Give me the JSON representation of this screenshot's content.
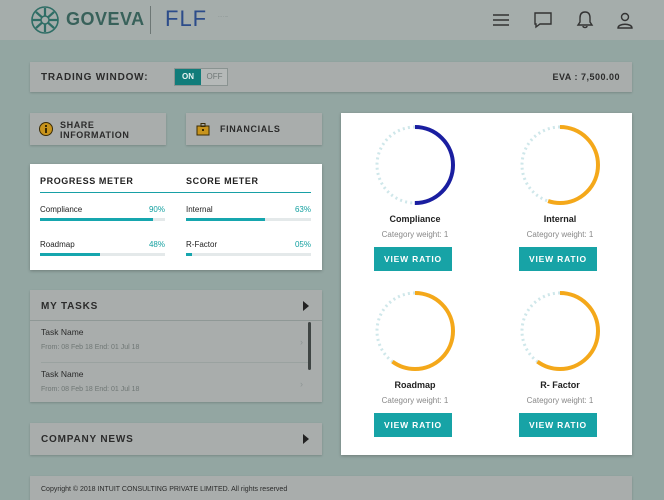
{
  "header": {
    "brand": "GOVEVA",
    "partner": "FLF",
    "partner_sub": "··· ····",
    "icons": [
      "menu-icon",
      "chat-icon",
      "bell-icon",
      "user-icon"
    ]
  },
  "trading": {
    "label": "TRADING WINDOW:",
    "on": "ON",
    "off": "OFF",
    "eva": "EVA : 7,500.00"
  },
  "buttons": {
    "share": "SHARE INFORMATION",
    "financials": "FINANCIALS"
  },
  "meters": {
    "progress_title": "PROGRESS METER",
    "score_title": "SCORE METER",
    "progress": [
      {
        "name": "Compliance",
        "percent": "90%",
        "value": 90
      },
      {
        "name": "Roadmap",
        "percent": "48%",
        "value": 48
      }
    ],
    "score": [
      {
        "name": "Internal",
        "percent": "63%",
        "value": 63
      },
      {
        "name": "R-Factor",
        "percent": "05%",
        "value": 5
      }
    ]
  },
  "tasks": {
    "title": "MY TASKS",
    "items": [
      {
        "name": "Task Name",
        "dates": "From: 08 Feb 18   End: 01 Jul 18"
      },
      {
        "name": "Task Name",
        "dates": "From: 08 Feb 18   End: 01 Jul 18"
      }
    ]
  },
  "news": {
    "title": "COMPANY NEWS"
  },
  "footer": {
    "text": "Copyright © 2018 INTUIT CONSULTING PRIVATE LIMITED. All rights reserved"
  },
  "ratios": [
    {
      "title": "Compliance",
      "weight": "Category weight: 1",
      "button": "VIEW RATIO",
      "value": 0.5,
      "color": "#1a1ea0"
    },
    {
      "title": "Internal",
      "weight": "Category weight: 1",
      "button": "VIEW RATIO",
      "value": 0.55,
      "color": "#f4a81a"
    },
    {
      "title": "Roadmap",
      "weight": "Category weight: 1",
      "button": "VIEW RATIO",
      "value": 0.6,
      "color": "#f4a81a"
    },
    {
      "title": "R- Factor",
      "weight": "Category weight: 1",
      "button": "VIEW RATIO",
      "value": 0.6,
      "color": "#f4a81a"
    }
  ],
  "colors": {
    "accent": "#17a3a6",
    "navy": "#1a1ea0",
    "orange": "#f4a81a"
  }
}
